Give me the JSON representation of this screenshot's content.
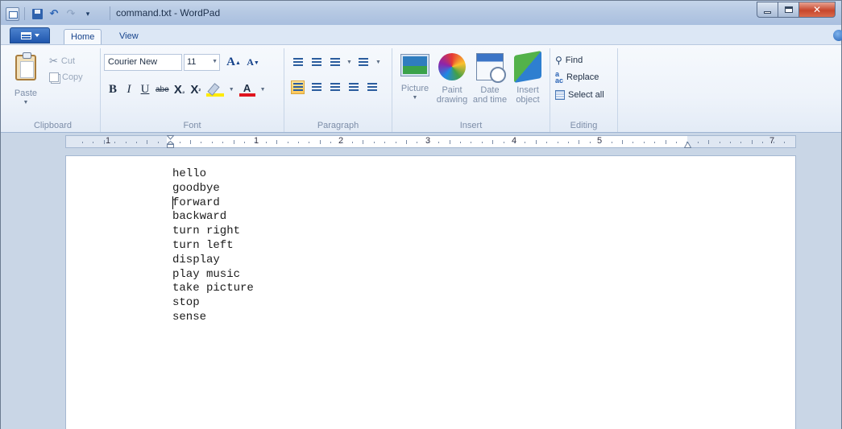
{
  "window": {
    "title": "command.txt - WordPad"
  },
  "quick_access": {
    "dropdown_glyph": "▾"
  },
  "tabs": [
    {
      "label": "Home",
      "active": true
    },
    {
      "label": "View",
      "active": false
    }
  ],
  "ribbon": {
    "clipboard": {
      "group_label": "Clipboard",
      "paste_label": "Paste",
      "cut_label": "Cut",
      "copy_label": "Copy"
    },
    "font": {
      "group_label": "Font",
      "font_name": "Courier New",
      "font_size": "11",
      "grow_label": "A",
      "shrink_label": "A",
      "bold": "B",
      "italic": "I",
      "underline": "U",
      "strikethrough": "abe",
      "subscript": "X",
      "superscript": "X",
      "font_color_letter": "A",
      "highlight_color": "#ffea00",
      "font_color": "#e0141e"
    },
    "paragraph": {
      "group_label": "Paragraph",
      "active_alignment": "left"
    },
    "insert": {
      "group_label": "Insert",
      "picture_label": "Picture",
      "paint_label": "Paint drawing",
      "date_label": "Date and time",
      "object_label": "Insert object"
    },
    "editing": {
      "group_label": "Editing",
      "find_label": "Find",
      "replace_label": "Replace",
      "select_all_label": "Select all"
    }
  },
  "ruler": {
    "numbers": [
      "1",
      "1",
      "2",
      "3",
      "4",
      "5",
      "7"
    ]
  },
  "document": {
    "lines": [
      "hello",
      "goodbye",
      "forward",
      "backward",
      "turn right",
      "turn left",
      "display",
      "play music",
      "take picture",
      "stop",
      "sense"
    ]
  },
  "colors": {
    "title_bar": "#b6c9e3",
    "app_menu": "#2a63b5",
    "close_button": "#c7462c",
    "workspace": "#c9d6e6"
  }
}
